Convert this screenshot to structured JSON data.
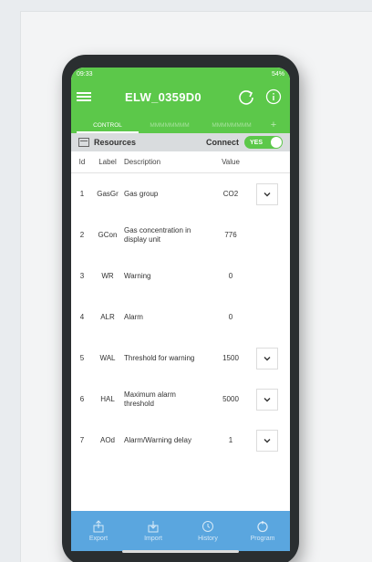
{
  "status_bar": {
    "time": "09:33",
    "battery": "54%"
  },
  "app_bar": {
    "title": "ELW_0359D0"
  },
  "tabs": [
    {
      "label": "CONTROL",
      "active": true
    },
    {
      "label": "MMMMMMMM",
      "active": false
    },
    {
      "label": "MMMMMMMM",
      "active": false
    },
    {
      "label": "+",
      "active": false
    }
  ],
  "resources_bar": {
    "label": "Resources",
    "connect_label": "Connect",
    "toggle_label": "YES",
    "toggle_on": true
  },
  "table": {
    "headers": {
      "id": "Id",
      "label": "Label",
      "description": "Description",
      "value": "Value"
    },
    "rows": [
      {
        "id": "1",
        "label": "GasGr",
        "description": "Gas group",
        "value": "CO2",
        "dropdown": true
      },
      {
        "id": "2",
        "label": "GCon",
        "description": "Gas concentration in display unit",
        "value": "776",
        "dropdown": false
      },
      {
        "id": "3",
        "label": "WR",
        "description": "Warning",
        "value": "0",
        "dropdown": false
      },
      {
        "id": "4",
        "label": "ALR",
        "description": "Alarm",
        "value": "0",
        "dropdown": false
      },
      {
        "id": "5",
        "label": "WAL",
        "description": "Threshold for warning",
        "value": "1500",
        "dropdown": true
      },
      {
        "id": "6",
        "label": "HAL",
        "description": "Maximum alarm threshold",
        "value": "5000",
        "dropdown": true
      },
      {
        "id": "7",
        "label": "AOd",
        "description": "Alarm/Warning delay",
        "value": "1",
        "dropdown": true
      }
    ]
  },
  "bottom_nav": [
    {
      "label": "Export",
      "icon": "export-icon"
    },
    {
      "label": "Import",
      "icon": "import-icon"
    },
    {
      "label": "History",
      "icon": "history-icon"
    },
    {
      "label": "Program",
      "icon": "program-icon"
    }
  ],
  "colors": {
    "primary": "#5cc84a",
    "bottom_bar": "#5aa6df",
    "resources_bar": "#d9dcde"
  }
}
